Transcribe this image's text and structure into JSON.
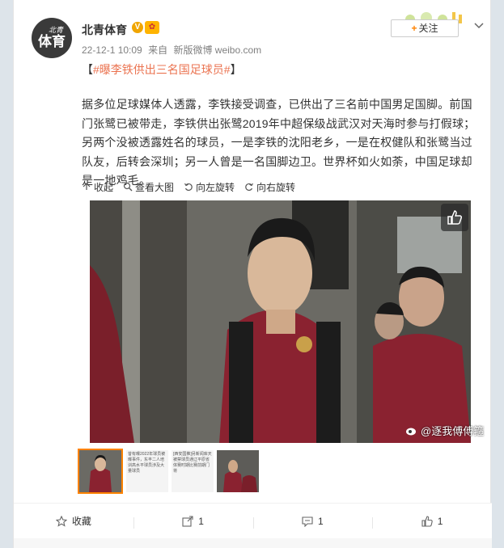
{
  "post": {
    "avatar_text_top": "北青",
    "avatar_text_main": "体育",
    "author": "北青体育",
    "verified_mark": "V",
    "date": "22-12-1 10:09",
    "from_label": "来自",
    "source": "新版微博 weibo.com",
    "follow_label": "关注",
    "topic_open": "【",
    "topic": "#曝李铁供出三名国足球员#",
    "topic_close": "】",
    "body": "据多位足球媒体人透露，李铁接受调查，已供出了三名前中国男足国脚。前国门张鹭已被带走，李铁供出张鹭2019年中超保级战武汉对天海时参与打假球；另两个没被透露姓名的球员，一是李铁的沈阳老乡，一是在权健队和张鹭当过队友，后转会深圳；另一人曾是一名国脚边卫。世界杯如火如荼，中国足球却是一地鸡毛。",
    "watermark": "@逐我傅傅箍"
  },
  "toolbar": {
    "collapse": "收起",
    "view_large": "查看大图",
    "rotate_left": "向左旋转",
    "rotate_right": "向右旋转"
  },
  "thumbnails": [
    {
      "kind": "photo",
      "selected": true
    },
    {
      "kind": "text",
      "text": "昔有曝2022年球员被曝事件，东丰二人培训高水平球员涉及大量球员",
      "selected": false
    },
    {
      "kind": "text",
      "text": "[西安国推]另新闻库天被禁球员通辽平原省体赛时期比赛前期门将",
      "selected": false
    },
    {
      "kind": "photo",
      "selected": false
    }
  ],
  "footer": {
    "collect": "收藏",
    "repost_count": "1",
    "comment_count": "1",
    "like_count": "1"
  },
  "colors": {
    "accent_orange": "#ff8200",
    "topic_link": "#eb7350",
    "jersey_red": "#8a2230",
    "page_bg": "#dde4ea"
  },
  "icons": [
    "verified-icon",
    "level-badge-icon",
    "chevron-down-icon",
    "collapse-icon",
    "magnify-icon",
    "rotate-left-icon",
    "rotate-right-icon",
    "thumbs-up-icon",
    "collect-icon",
    "repost-icon",
    "comment-icon",
    "like-icon"
  ]
}
